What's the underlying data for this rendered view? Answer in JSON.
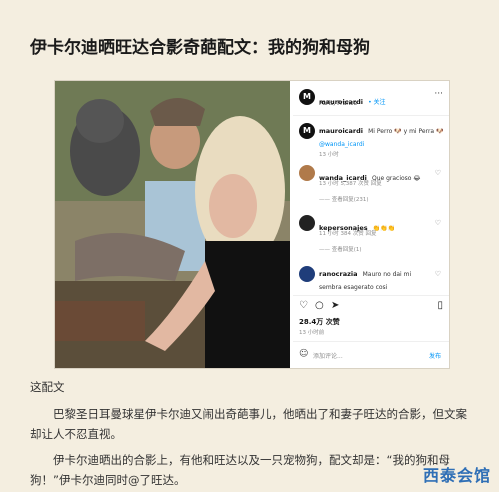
{
  "article": {
    "title": "伊卡尔迪晒旺达合影奇葩配文：我的狗和母狗",
    "caption_label": "这配文",
    "para1": "巴黎圣日耳曼球星伊卡尔迪又闹出奇葩事儿，他晒出了和妻子旺达的合影，但文案却让人不忍直视。",
    "para2": "伊卡尔迪晒出的合影上，有他和旺达以及一只宠物狗，配文却是：“我的狗和母狗！”伊卡尔迪同时@了旺达。",
    "watermark": "西泰会馆"
  },
  "post": {
    "username": "mauroicardi",
    "follow": "• 关注",
    "location": "Paris, France",
    "caption_user": "mauroicardi",
    "caption_text": "Mi Perro 🐶 y mi Perra 🐶",
    "caption_mention": "@wanda_icardi",
    "caption_time": "13 小时",
    "comments": [
      {
        "user": "wanda_icardi",
        "text": "Que gracioso 😂",
        "meta": "13 小时  5,387 次赞  回复",
        "replies": "—— 查看回复(231)"
      },
      {
        "user": "kepersonajes",
        "text": "👏👏👏",
        "meta": "11 小时  384 次赞  回复",
        "replies": "—— 查看回复(1)"
      },
      {
        "user": "ranocrazia",
        "text": "Mauro no dai mi sembra esagerato cosi",
        "meta": "",
        "replies": ""
      }
    ],
    "likes": "28.4万 次赞",
    "post_time": "13 小时前",
    "comment_placeholder": "添加评论...",
    "post_button": "发布"
  }
}
